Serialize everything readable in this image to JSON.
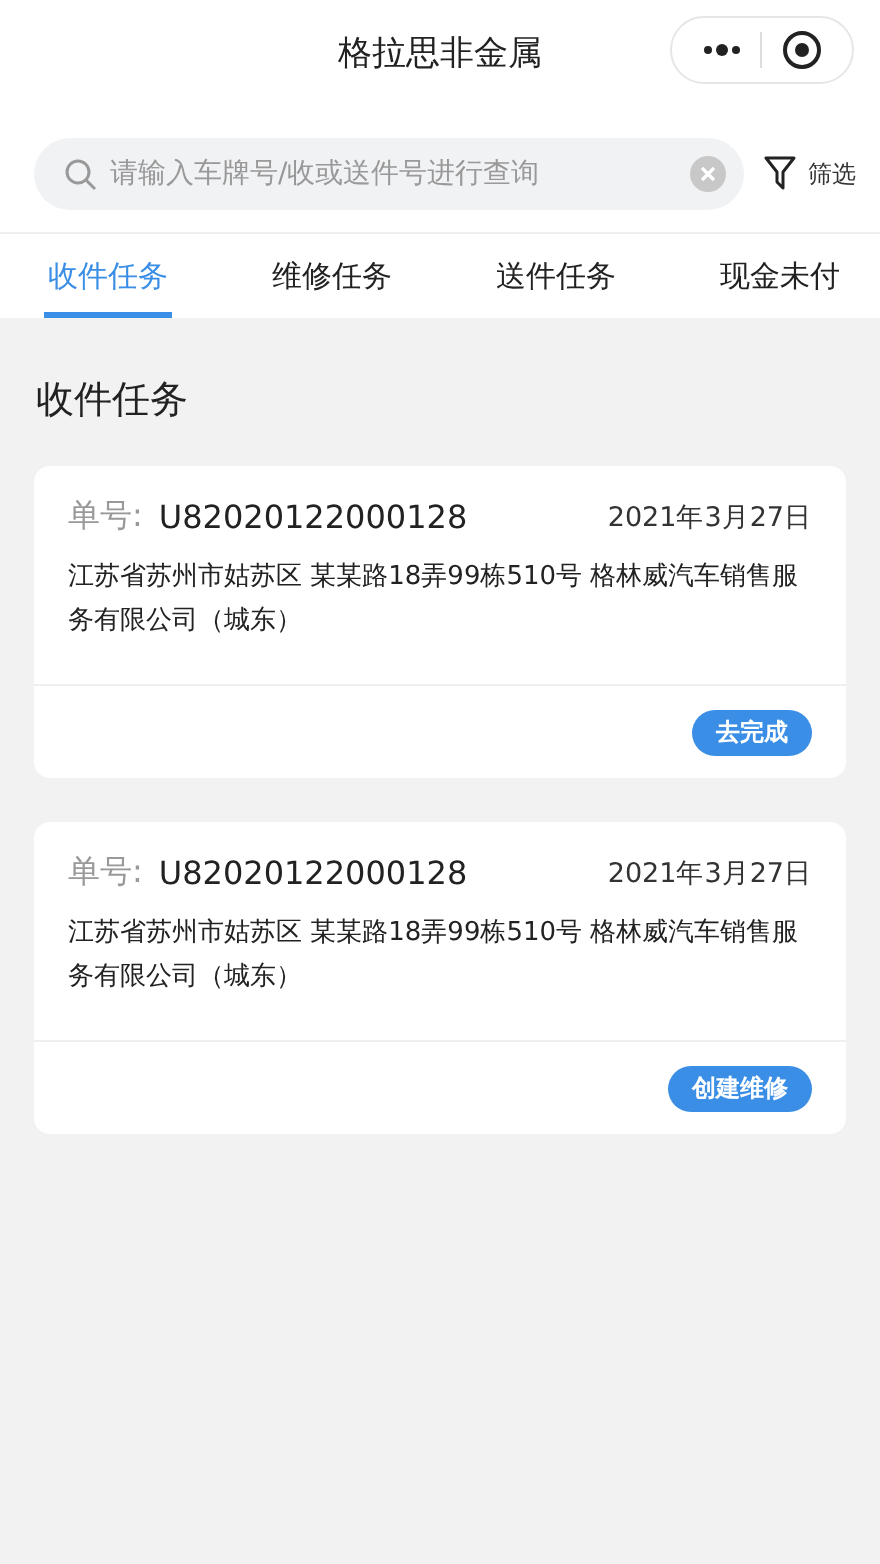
{
  "header": {
    "title": "格拉思非金属"
  },
  "search": {
    "placeholder": "请输入车牌号/收或送件号进行查询",
    "filter_label": "筛选"
  },
  "tabs": [
    {
      "label": "收件任务",
      "selected": true
    },
    {
      "label": "维修任务",
      "selected": false
    },
    {
      "label": "送件任务",
      "selected": false
    },
    {
      "label": "现金未付",
      "selected": false
    }
  ],
  "section_title": "收件任务",
  "cards": [
    {
      "number_label": "单号:",
      "number": "U82020122000128",
      "date": "2021年3月27日",
      "address": "江苏省苏州市姑苏区 某某路18弄99栋510号 格林威汽车销售服务有限公司（城东）",
      "action": "去完成"
    },
    {
      "number_label": "单号:",
      "number": "U82020122000128",
      "date": "2021年3月27日",
      "address": "江苏省苏州市姑苏区 某某路18弄99栋510号 格林威汽车销售服务有限公司（城东）",
      "action": "创建维修"
    }
  ]
}
